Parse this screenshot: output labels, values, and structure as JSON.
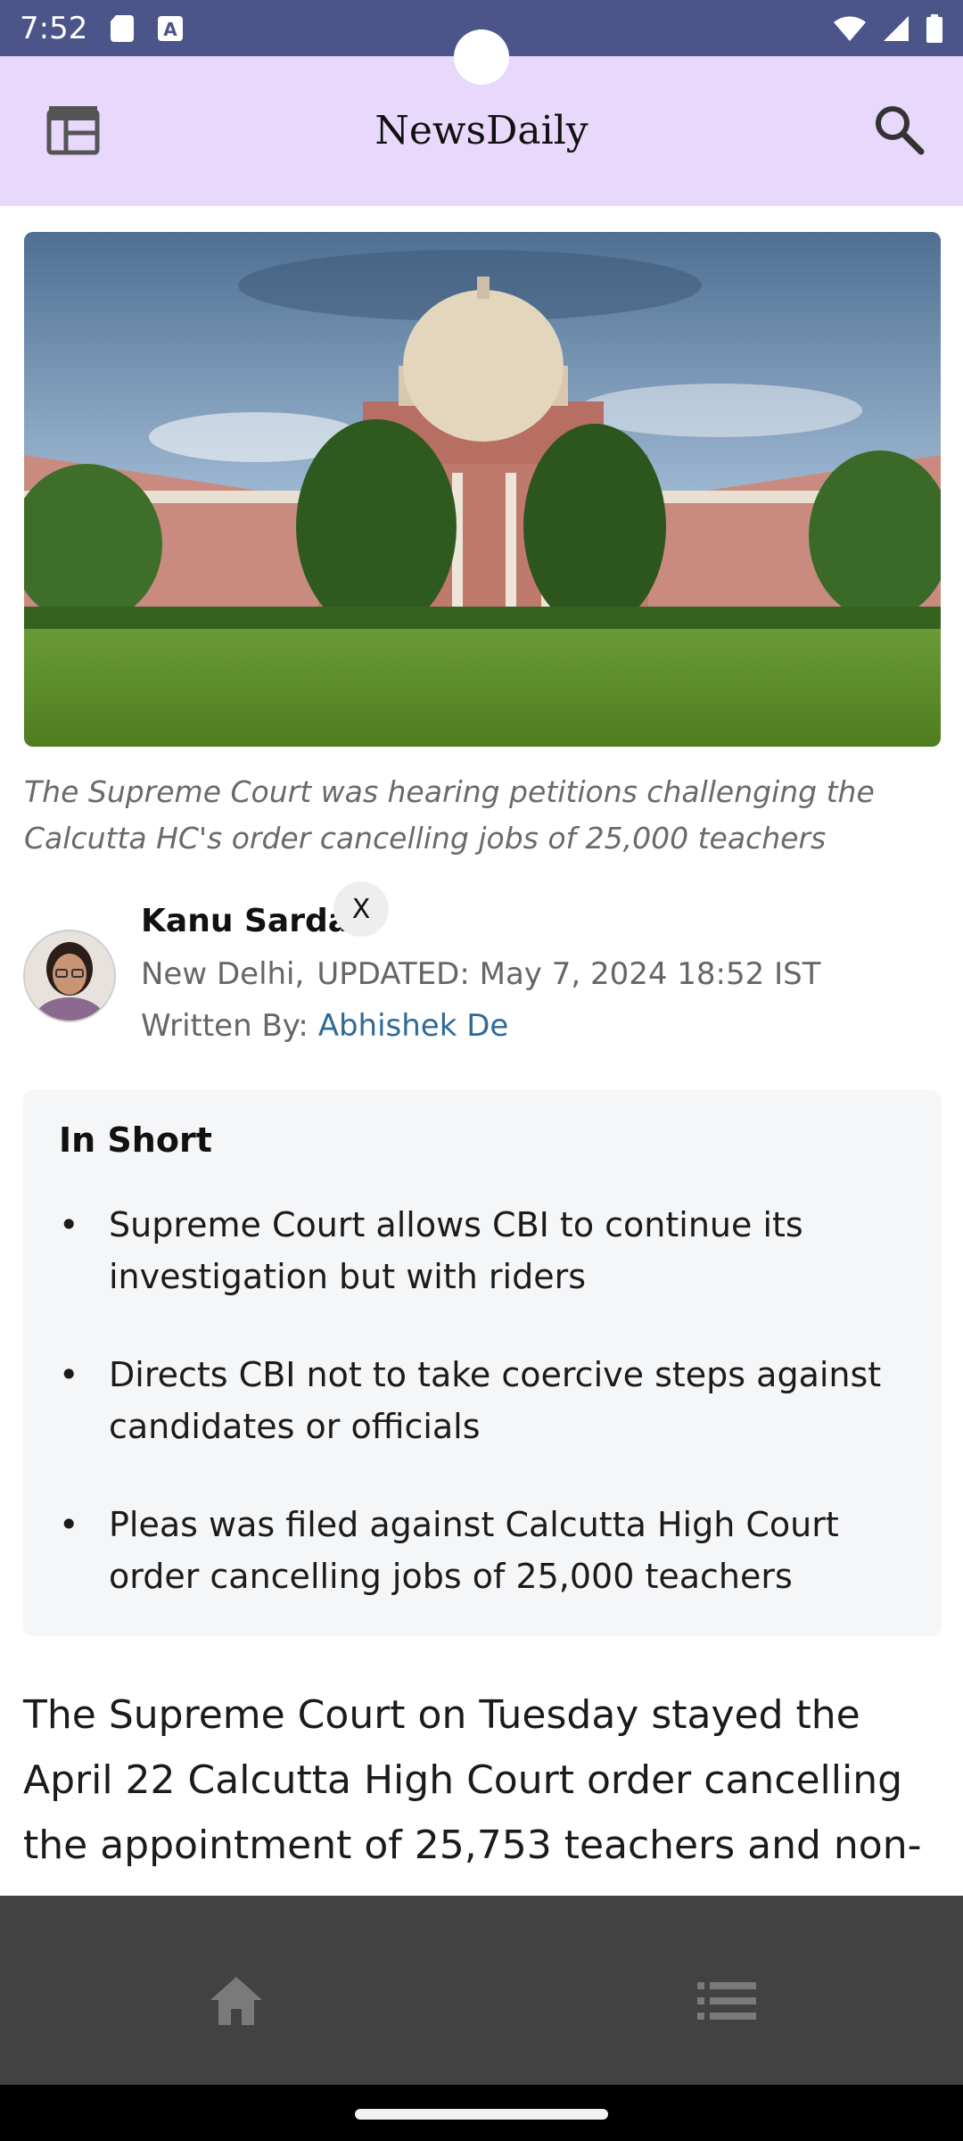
{
  "status_bar": {
    "time": "7:52"
  },
  "app_bar": {
    "title": "NewsDaily",
    "menu_icon": "news-layout-icon",
    "search_icon": "search-icon"
  },
  "article": {
    "caption": "The Supreme Court was hearing petitions challenging the Calcutta HC's order cancelling jobs of 25,000 teachers",
    "author": "Kanu Sarda",
    "location": "New Delhi,",
    "updated": "UPDATED: May 7, 2024 18:52 IST",
    "written_by_label": "Written By:",
    "written_by_name": "Abhishek De",
    "social_icon": "X",
    "in_short": {
      "title": "In Short",
      "points": [
        "Supreme Court allows CBI to continue its investigation but with riders",
        "Directs CBI not to take coercive steps against candidates or officials",
        "Pleas was filed against Calcutta High Court order cancelling jobs of 25,000 teachers"
      ]
    },
    "body": "The Supreme Court on Tuesday stayed the April 22 Calcutta High Court order cancelling the appointment of 25,753 teachers and non-"
  },
  "bottom_nav": {
    "home_icon": "home-icon",
    "list_icon": "list-icon"
  },
  "colors": {
    "status_bar": "#4b5589",
    "app_bar": "#e8d8fb",
    "bottom_nav": "#424242",
    "link": "#2f6a97"
  }
}
